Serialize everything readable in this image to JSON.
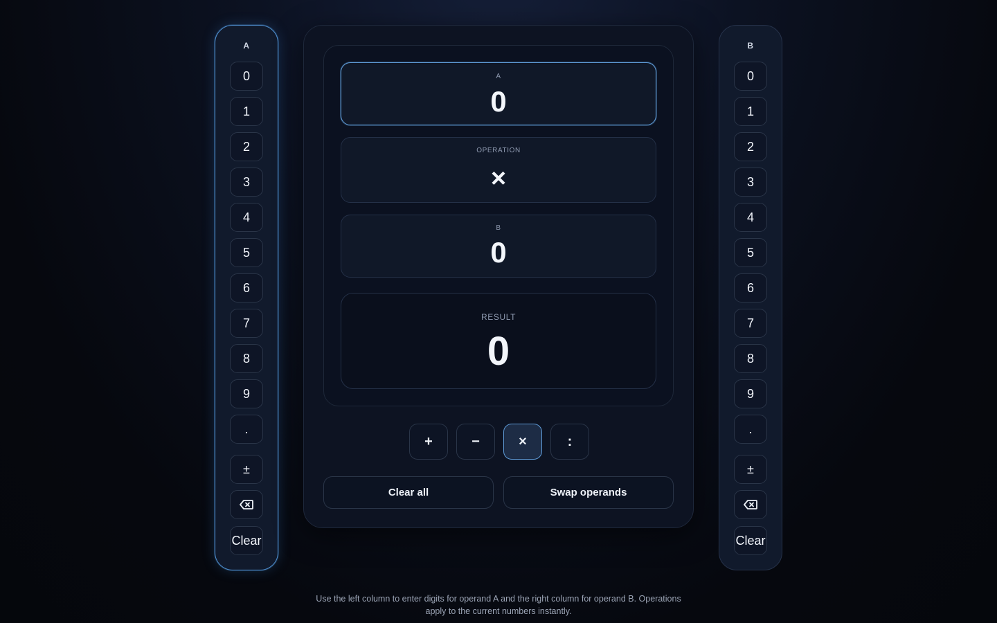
{
  "left_column": {
    "title": "A",
    "keys": [
      "0",
      "1",
      "2",
      "3",
      "4",
      "5",
      "6",
      "7",
      "8",
      "9",
      ".",
      "±",
      "⌫",
      "Clear"
    ]
  },
  "right_column": {
    "title": "B",
    "keys": [
      "0",
      "1",
      "2",
      "3",
      "4",
      "5",
      "6",
      "7",
      "8",
      "9",
      ".",
      "±",
      "⌫",
      "Clear"
    ]
  },
  "display": {
    "a": {
      "label": "A",
      "value": "0"
    },
    "operation": {
      "label": "OPERATION",
      "value": "×"
    },
    "b": {
      "label": "B",
      "value": "0"
    },
    "result": {
      "label": "RESULT",
      "value": "0"
    }
  },
  "operators": {
    "plus": "+",
    "minus": "−",
    "times": "×",
    "divide": ":",
    "active": "times"
  },
  "actions": {
    "clear_all": "Clear all",
    "swap": "Swap operands"
  },
  "footer": {
    "hint": "Use the left column to enter digits for operand A and the right column for operand B. Operations apply to the current numbers instantly."
  },
  "colors": {
    "accent": "#5e9ad6",
    "background": "#0b1120"
  }
}
